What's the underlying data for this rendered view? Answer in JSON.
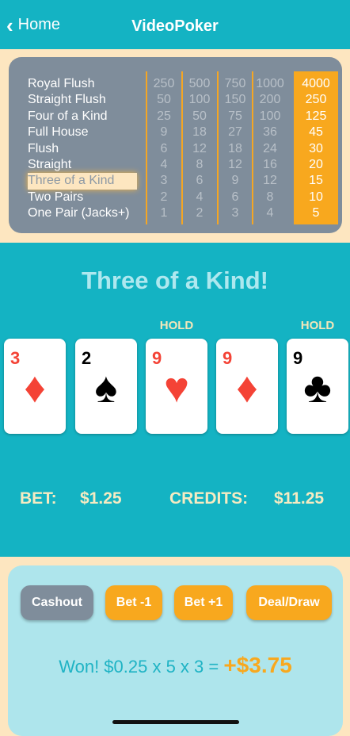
{
  "header": {
    "back_label": "Home",
    "title": "VideoPoker"
  },
  "paytable": {
    "hands": [
      "Royal Flush",
      "Straight Flush",
      "Four of a Kind",
      "Full House",
      "Flush",
      "Straight",
      "Three of a Kind",
      "Two Pairs",
      "One Pair (Jacks+)"
    ],
    "highlighted_hand": "Three of a Kind",
    "columns": [
      [
        "250",
        "50",
        "25",
        "9",
        "6",
        "4",
        "3",
        "2",
        "1"
      ],
      [
        "500",
        "100",
        "50",
        "18",
        "12",
        "8",
        "6",
        "4",
        "2"
      ],
      [
        "750",
        "150",
        "75",
        "27",
        "18",
        "12",
        "9",
        "6",
        "3"
      ],
      [
        "1000",
        "200",
        "100",
        "36",
        "24",
        "16",
        "12",
        "8",
        "4"
      ],
      [
        "4000",
        "250",
        "125",
        "45",
        "30",
        "20",
        "15",
        "10",
        "5"
      ]
    ],
    "active_column": 5
  },
  "result_text": "Three of a Kind!",
  "hold_label": "HOLD",
  "cards": [
    {
      "rank": "3",
      "suit": "♦",
      "color": "red",
      "held": false
    },
    {
      "rank": "2",
      "suit": "♠",
      "color": "black",
      "held": false
    },
    {
      "rank": "9",
      "suit": "♥",
      "color": "red",
      "held": true
    },
    {
      "rank": "9",
      "suit": "♦",
      "color": "red",
      "held": false
    },
    {
      "rank": "9",
      "suit": "♣",
      "color": "black",
      "held": true
    }
  ],
  "bet": {
    "label": "BET:",
    "value": "$1.25"
  },
  "credits": {
    "label": "CREDITS:",
    "value": "$11.25"
  },
  "buttons": {
    "cashout": "Cashout",
    "bet_minus": "Bet -1",
    "bet_plus": "Bet +1",
    "deal_draw": "Deal/Draw"
  },
  "win": {
    "text": "Won! $0.25 x 5 x 3 = ",
    "amount": "+$3.75"
  },
  "colors": {
    "teal": "#14b3c3",
    "orange": "#f8a81e",
    "gray": "#7f8d9b",
    "beige": "#fde6c0"
  }
}
